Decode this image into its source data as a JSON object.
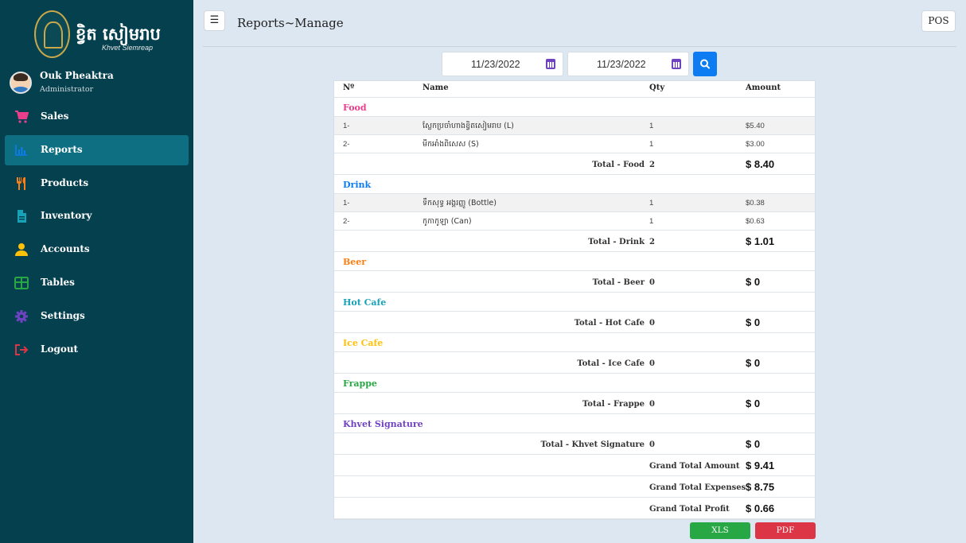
{
  "sidebar": {
    "brand_khmer": "ខ្វិត សៀមរាប",
    "brand_en": "Khvet Siemreap",
    "user": {
      "name": "Ouk Pheaktra",
      "role": "Administrator"
    },
    "items": [
      {
        "label": "Sales",
        "icon": "cart-icon",
        "color": "#e83e8c",
        "active": false
      },
      {
        "label": "Reports",
        "icon": "chart-icon",
        "color": "#0d7cf2",
        "active": true
      },
      {
        "label": "Products",
        "icon": "utensils-icon",
        "color": "#fd7e14",
        "active": false
      },
      {
        "label": "Inventory",
        "icon": "file-icon",
        "color": "#17a2b8",
        "active": false
      },
      {
        "label": "Accounts",
        "icon": "user-icon",
        "color": "#ffc107",
        "active": false
      },
      {
        "label": "Tables",
        "icon": "table-icon",
        "color": "#28a745",
        "active": false
      },
      {
        "label": "Settings",
        "icon": "gear-icon",
        "color": "#6f42c1",
        "active": false
      },
      {
        "label": "Logout",
        "icon": "logout-icon",
        "color": "#dc3545",
        "active": false
      }
    ]
  },
  "topbar": {
    "menu_glyph": "☰",
    "title": "Reports~Manage",
    "pos_label": "POS"
  },
  "filters": {
    "date_from": "11/23/2022",
    "date_to": "11/23/2022"
  },
  "report": {
    "headers": {
      "no": "Nº",
      "name": "Name",
      "qty": "Qty",
      "amount": "Amount"
    },
    "categories": [
      {
        "name": "Food",
        "color": "#e83e8c",
        "items": [
          {
            "no": "1-",
            "name": "ស្លែកប្រចាំហាងខ្វិតសៀមរាប (L)",
            "qty": "1",
            "amount": "$5.40"
          },
          {
            "no": "2-",
            "name": "មីកអាំងពិសេស (S)",
            "qty": "1",
            "amount": "$3.00"
          }
        ],
        "total_label": "Total - Food",
        "total_qty": "2",
        "total_amount": "$ 8.40"
      },
      {
        "name": "Drink",
        "color": "#0d7cf2",
        "items": [
          {
            "no": "1-",
            "name": "ទឹកសុទ្ធ អង្គរញ្ញូ (Bottle)",
            "qty": "1",
            "amount": "$0.38"
          },
          {
            "no": "2-",
            "name": "កូកាកូឡា (Can)",
            "qty": "1",
            "amount": "$0.63"
          }
        ],
        "total_label": "Total - Drink",
        "total_qty": "2",
        "total_amount": "$ 1.01"
      },
      {
        "name": "Beer",
        "color": "#fd7e14",
        "items": [],
        "total_label": "Total - Beer",
        "total_qty": "0",
        "total_amount": "$ 0"
      },
      {
        "name": "Hot Cafe",
        "color": "#17a2b8",
        "items": [],
        "total_label": "Total - Hot Cafe",
        "total_qty": "0",
        "total_amount": "$ 0"
      },
      {
        "name": "Ice Cafe",
        "color": "#ffc107",
        "items": [],
        "total_label": "Total - Ice Cafe",
        "total_qty": "0",
        "total_amount": "$ 0"
      },
      {
        "name": "Frappe",
        "color": "#28a745",
        "items": [],
        "total_label": "Total - Frappe",
        "total_qty": "0",
        "total_amount": "$ 0"
      },
      {
        "name": "Khvet Signature",
        "color": "#6f42c1",
        "items": [],
        "total_label": "Total - Khvet Signature",
        "total_qty": "0",
        "total_amount": "$ 0"
      }
    ],
    "grand": [
      {
        "label": "Grand Total Amount",
        "value": "$ 9.41"
      },
      {
        "label": "Grand Total Expenses",
        "value": "$ 8.75"
      },
      {
        "label": "Grand Total Profit",
        "value": "$ 0.66"
      }
    ]
  },
  "buttons": {
    "xls": "XLS",
    "pdf": "PDF",
    "xls_color": "#28a745",
    "pdf_color": "#dc3545"
  }
}
